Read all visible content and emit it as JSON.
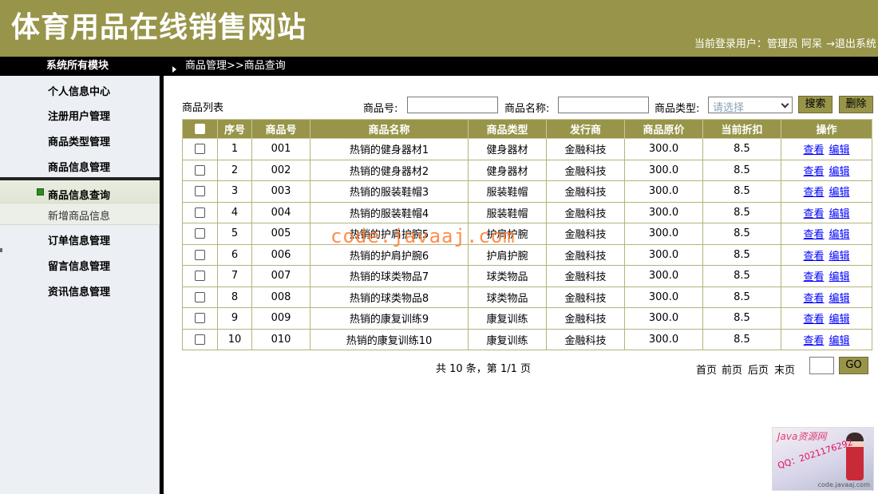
{
  "header": {
    "site_title": "体育用品在线销售网站",
    "user_info": "当前登录用户：管理员 阿呆",
    "logout": "→退出系统"
  },
  "topbar": {
    "sidebar_title": "系统所有模块",
    "breadcrumb": "商品管理>>商品查询"
  },
  "sidebar": {
    "items": [
      {
        "label": "个人信息中心"
      },
      {
        "label": "注册用户管理"
      },
      {
        "label": "商品类型管理"
      },
      {
        "label": "商品信息管理"
      },
      {
        "label": "商品信息查询",
        "active": true
      },
      {
        "label": "新增商品信息",
        "sub": true
      },
      {
        "label": "订单信息管理"
      },
      {
        "label": "留言信息管理"
      },
      {
        "label": "资讯信息管理"
      }
    ]
  },
  "search": {
    "list_title": "商品列表",
    "code_label": "商品号:",
    "code_value": "",
    "name_label": "商品名称:",
    "name_value": "",
    "type_label": "商品类型:",
    "type_selected": "请选择",
    "search_button": "搜索",
    "delete_button": "删除"
  },
  "table": {
    "headers": [
      "",
      "序号",
      "商品号",
      "商品名称",
      "商品类型",
      "发行商",
      "商品原价",
      "当前折扣",
      "操作"
    ],
    "view_label": "查看",
    "edit_label": "编辑",
    "rows": [
      {
        "no": "1",
        "code": "001",
        "name": "热销的健身器材1",
        "type": "健身器材",
        "publisher": "金融科技",
        "price": "300.0",
        "discount": "8.5"
      },
      {
        "no": "2",
        "code": "002",
        "name": "热销的健身器材2",
        "type": "健身器材",
        "publisher": "金融科技",
        "price": "300.0",
        "discount": "8.5"
      },
      {
        "no": "3",
        "code": "003",
        "name": "热销的服装鞋帽3",
        "type": "服装鞋帽",
        "publisher": "金融科技",
        "price": "300.0",
        "discount": "8.5"
      },
      {
        "no": "4",
        "code": "004",
        "name": "热销的服装鞋帽4",
        "type": "服装鞋帽",
        "publisher": "金融科技",
        "price": "300.0",
        "discount": "8.5"
      },
      {
        "no": "5",
        "code": "005",
        "name": "热销的护肩护腕5",
        "type": "护肩护腕",
        "publisher": "金融科技",
        "price": "300.0",
        "discount": "8.5"
      },
      {
        "no": "6",
        "code": "006",
        "name": "热销的护肩护腕6",
        "type": "护肩护腕",
        "publisher": "金融科技",
        "price": "300.0",
        "discount": "8.5"
      },
      {
        "no": "7",
        "code": "007",
        "name": "热销的球类物品7",
        "type": "球类物品",
        "publisher": "金融科技",
        "price": "300.0",
        "discount": "8.5"
      },
      {
        "no": "8",
        "code": "008",
        "name": "热销的球类物品8",
        "type": "球类物品",
        "publisher": "金融科技",
        "price": "300.0",
        "discount": "8.5"
      },
      {
        "no": "9",
        "code": "009",
        "name": "热销的康复训练9",
        "type": "康复训练",
        "publisher": "金融科技",
        "price": "300.0",
        "discount": "8.5"
      },
      {
        "no": "10",
        "code": "010",
        "name": "热销的康复训练10",
        "type": "康复训练",
        "publisher": "金融科技",
        "price": "300.0",
        "discount": "8.5"
      }
    ]
  },
  "pager": {
    "summary": "共 10 条，第 1/1 页",
    "first": "首页",
    "prev": "前页",
    "next": "后页",
    "last": "末页",
    "page_value": "",
    "go": "GO"
  },
  "watermark": "code.javaaj.com",
  "badge": {
    "title": "Java资源网",
    "qq": "QQ：2021176292",
    "url": "code.javaaj.com"
  },
  "colors": {
    "accent": "#98954a",
    "bar": "#000000",
    "sidebar_bg": "#ecf0f5",
    "link": "#0000ff"
  }
}
